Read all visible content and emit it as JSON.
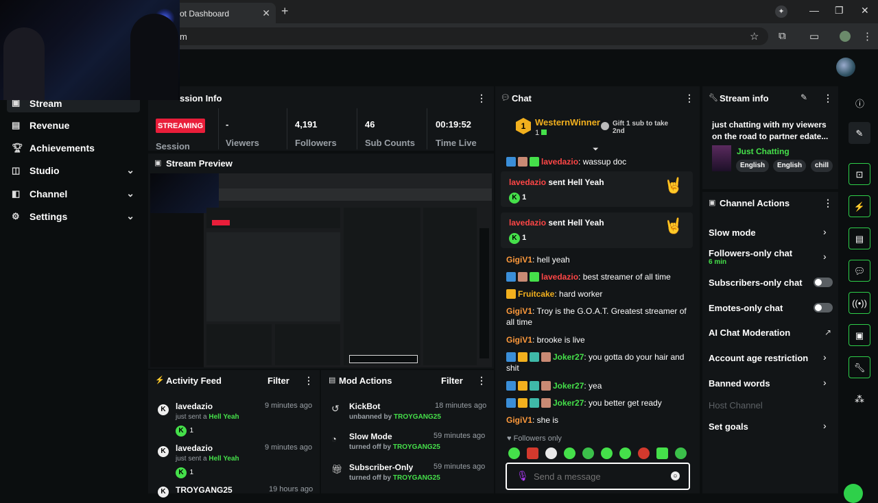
{
  "browser": {
    "tab_title": "ot Dashboard",
    "url": "m"
  },
  "sidebar": {
    "items": [
      {
        "label": "Stream",
        "icon": "stream-icon"
      },
      {
        "label": "Revenue",
        "icon": "revenue-icon"
      },
      {
        "label": "Achievements",
        "icon": "trophy-icon"
      },
      {
        "label": "Studio",
        "icon": "studio-icon"
      },
      {
        "label": "Channel",
        "icon": "channel-icon"
      },
      {
        "label": "Settings",
        "icon": "gear-icon"
      }
    ]
  },
  "session": {
    "title": "ssion Info",
    "status": "STREAMING",
    "session_label": "Session",
    "viewers_value": "-",
    "viewers_label": "Viewers",
    "followers_value": "4,191",
    "followers_label": "Followers",
    "subs_value": "46",
    "subs_label": "Sub Counts",
    "time_value": "00:19:52",
    "time_label": "Time Live"
  },
  "preview": {
    "title": "Stream Preview"
  },
  "activity": {
    "title": "Activity Feed",
    "filter": "Filter",
    "items": [
      {
        "user": "lavedazio",
        "time": "9 minutes ago",
        "text": "just sent a",
        "item": "Hell Yeah",
        "count": "1"
      },
      {
        "user": "lavedazio",
        "time": "9 minutes ago",
        "text": "just sent a",
        "item": "Hell Yeah",
        "count": "1"
      },
      {
        "user": "TROYGANG25",
        "time": "19 hours ago"
      }
    ]
  },
  "mod": {
    "title": "Mod Actions",
    "filter": "Filter",
    "items": [
      {
        "title": "KickBot",
        "time": "18 minutes ago",
        "action": "unbanned by",
        "by": "TROYGANG25"
      },
      {
        "title": "Slow Mode",
        "time": "59 minutes ago",
        "action": "turned off by",
        "by": "TROYGANG25"
      },
      {
        "title": "Subscriber-Only",
        "time": "59 minutes ago",
        "action": "turned off by",
        "by": "TROYGANG25"
      }
    ]
  },
  "chat": {
    "title": "Chat",
    "pinned_rank": "1",
    "pinned_user": "WesternWinner",
    "pinned_sub": "1",
    "gift_text": "Gift 1 sub to take 2nd",
    "messages": [
      {
        "user": "lavedazio",
        "text": ": wassup doc"
      },
      {
        "user": "lavedazio",
        "text": " sent Hell Yeah",
        "count": "1"
      },
      {
        "user": "lavedazio",
        "text": " sent Hell Yeah",
        "count": "1"
      },
      {
        "user": "GigiV1",
        "text": ": hell yeah"
      },
      {
        "user": "lavedazio",
        "text": ": best streamer of all time"
      },
      {
        "user": "Fruitcake",
        "text": ": hard worker"
      },
      {
        "user": "GigiV1",
        "text": ": Troy is the G.O.A.T. Greatest streamer of all time"
      },
      {
        "user": "GigiV1",
        "text": ": brooke is live"
      },
      {
        "user": "Joker27",
        "text": ": you gotta do your hair and shit"
      },
      {
        "user": "Joker27",
        "text": ": yea"
      },
      {
        "user": "Joker27",
        "text": ": you better get ready"
      },
      {
        "user": "GigiV1",
        "text": ": she is"
      }
    ],
    "followers_only": "Followers only",
    "placeholder": "Send a message"
  },
  "stream_info": {
    "title": "Stream info",
    "stream_title": "just chatting with my viewers on the road to partner edate...",
    "category": "Just Chatting",
    "tags": [
      "English",
      "English",
      "chill"
    ]
  },
  "channel_actions": {
    "title": "Channel Actions",
    "items": [
      {
        "label": "Slow mode"
      },
      {
        "label": "Followers-only chat",
        "sub": "6 min"
      },
      {
        "label": "Subscribers-only chat"
      },
      {
        "label": "Emotes-only chat"
      },
      {
        "label": "AI Chat Moderation"
      },
      {
        "label": "Account age restriction"
      },
      {
        "label": "Banned words"
      },
      {
        "label": "Host Channel"
      },
      {
        "label": "Set goals"
      }
    ]
  },
  "colors": {
    "accent": "#45e04a",
    "live": "#e91e3a",
    "username_red": "#ff4646"
  }
}
